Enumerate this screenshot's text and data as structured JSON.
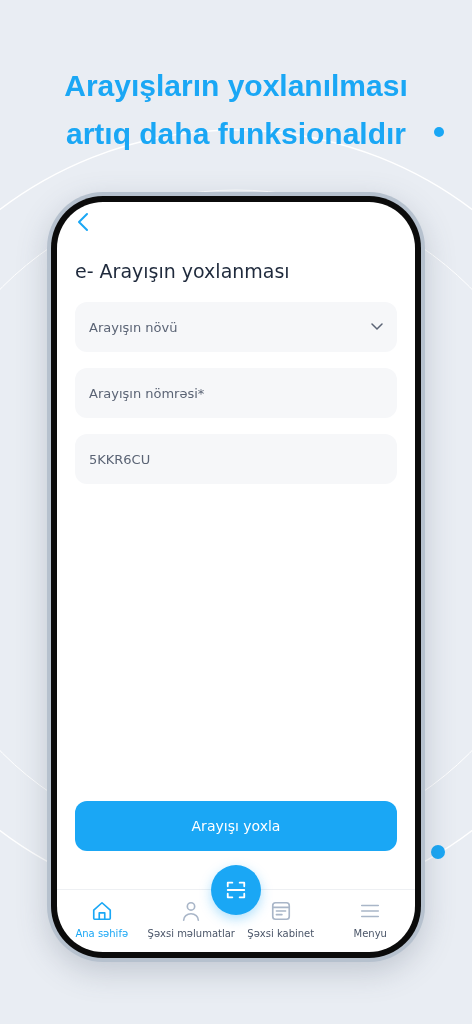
{
  "headline": [
    "Arayışların yoxlanılması",
    "artıq daha funksionaldır"
  ],
  "screen": {
    "title": "e- Arayışın yoxlanması",
    "fields": [
      {
        "kind": "select",
        "placeholder": "Arayışın növü"
      },
      {
        "kind": "text",
        "placeholder": "Arayışın nömrəsi*"
      },
      {
        "kind": "text",
        "value": "5KKR6CU"
      }
    ],
    "submit": "Arayışı yoxla",
    "nav": [
      {
        "kind": "home",
        "label": "Ana səhifə",
        "selected": true
      },
      {
        "kind": "person",
        "label": "Şəxsi məlumatlar",
        "selected": false
      },
      {
        "kind": "cabinet",
        "label": "Şəxsi kabinet",
        "selected": false
      },
      {
        "kind": "menu",
        "label": "Menyu",
        "selected": false
      }
    ]
  }
}
